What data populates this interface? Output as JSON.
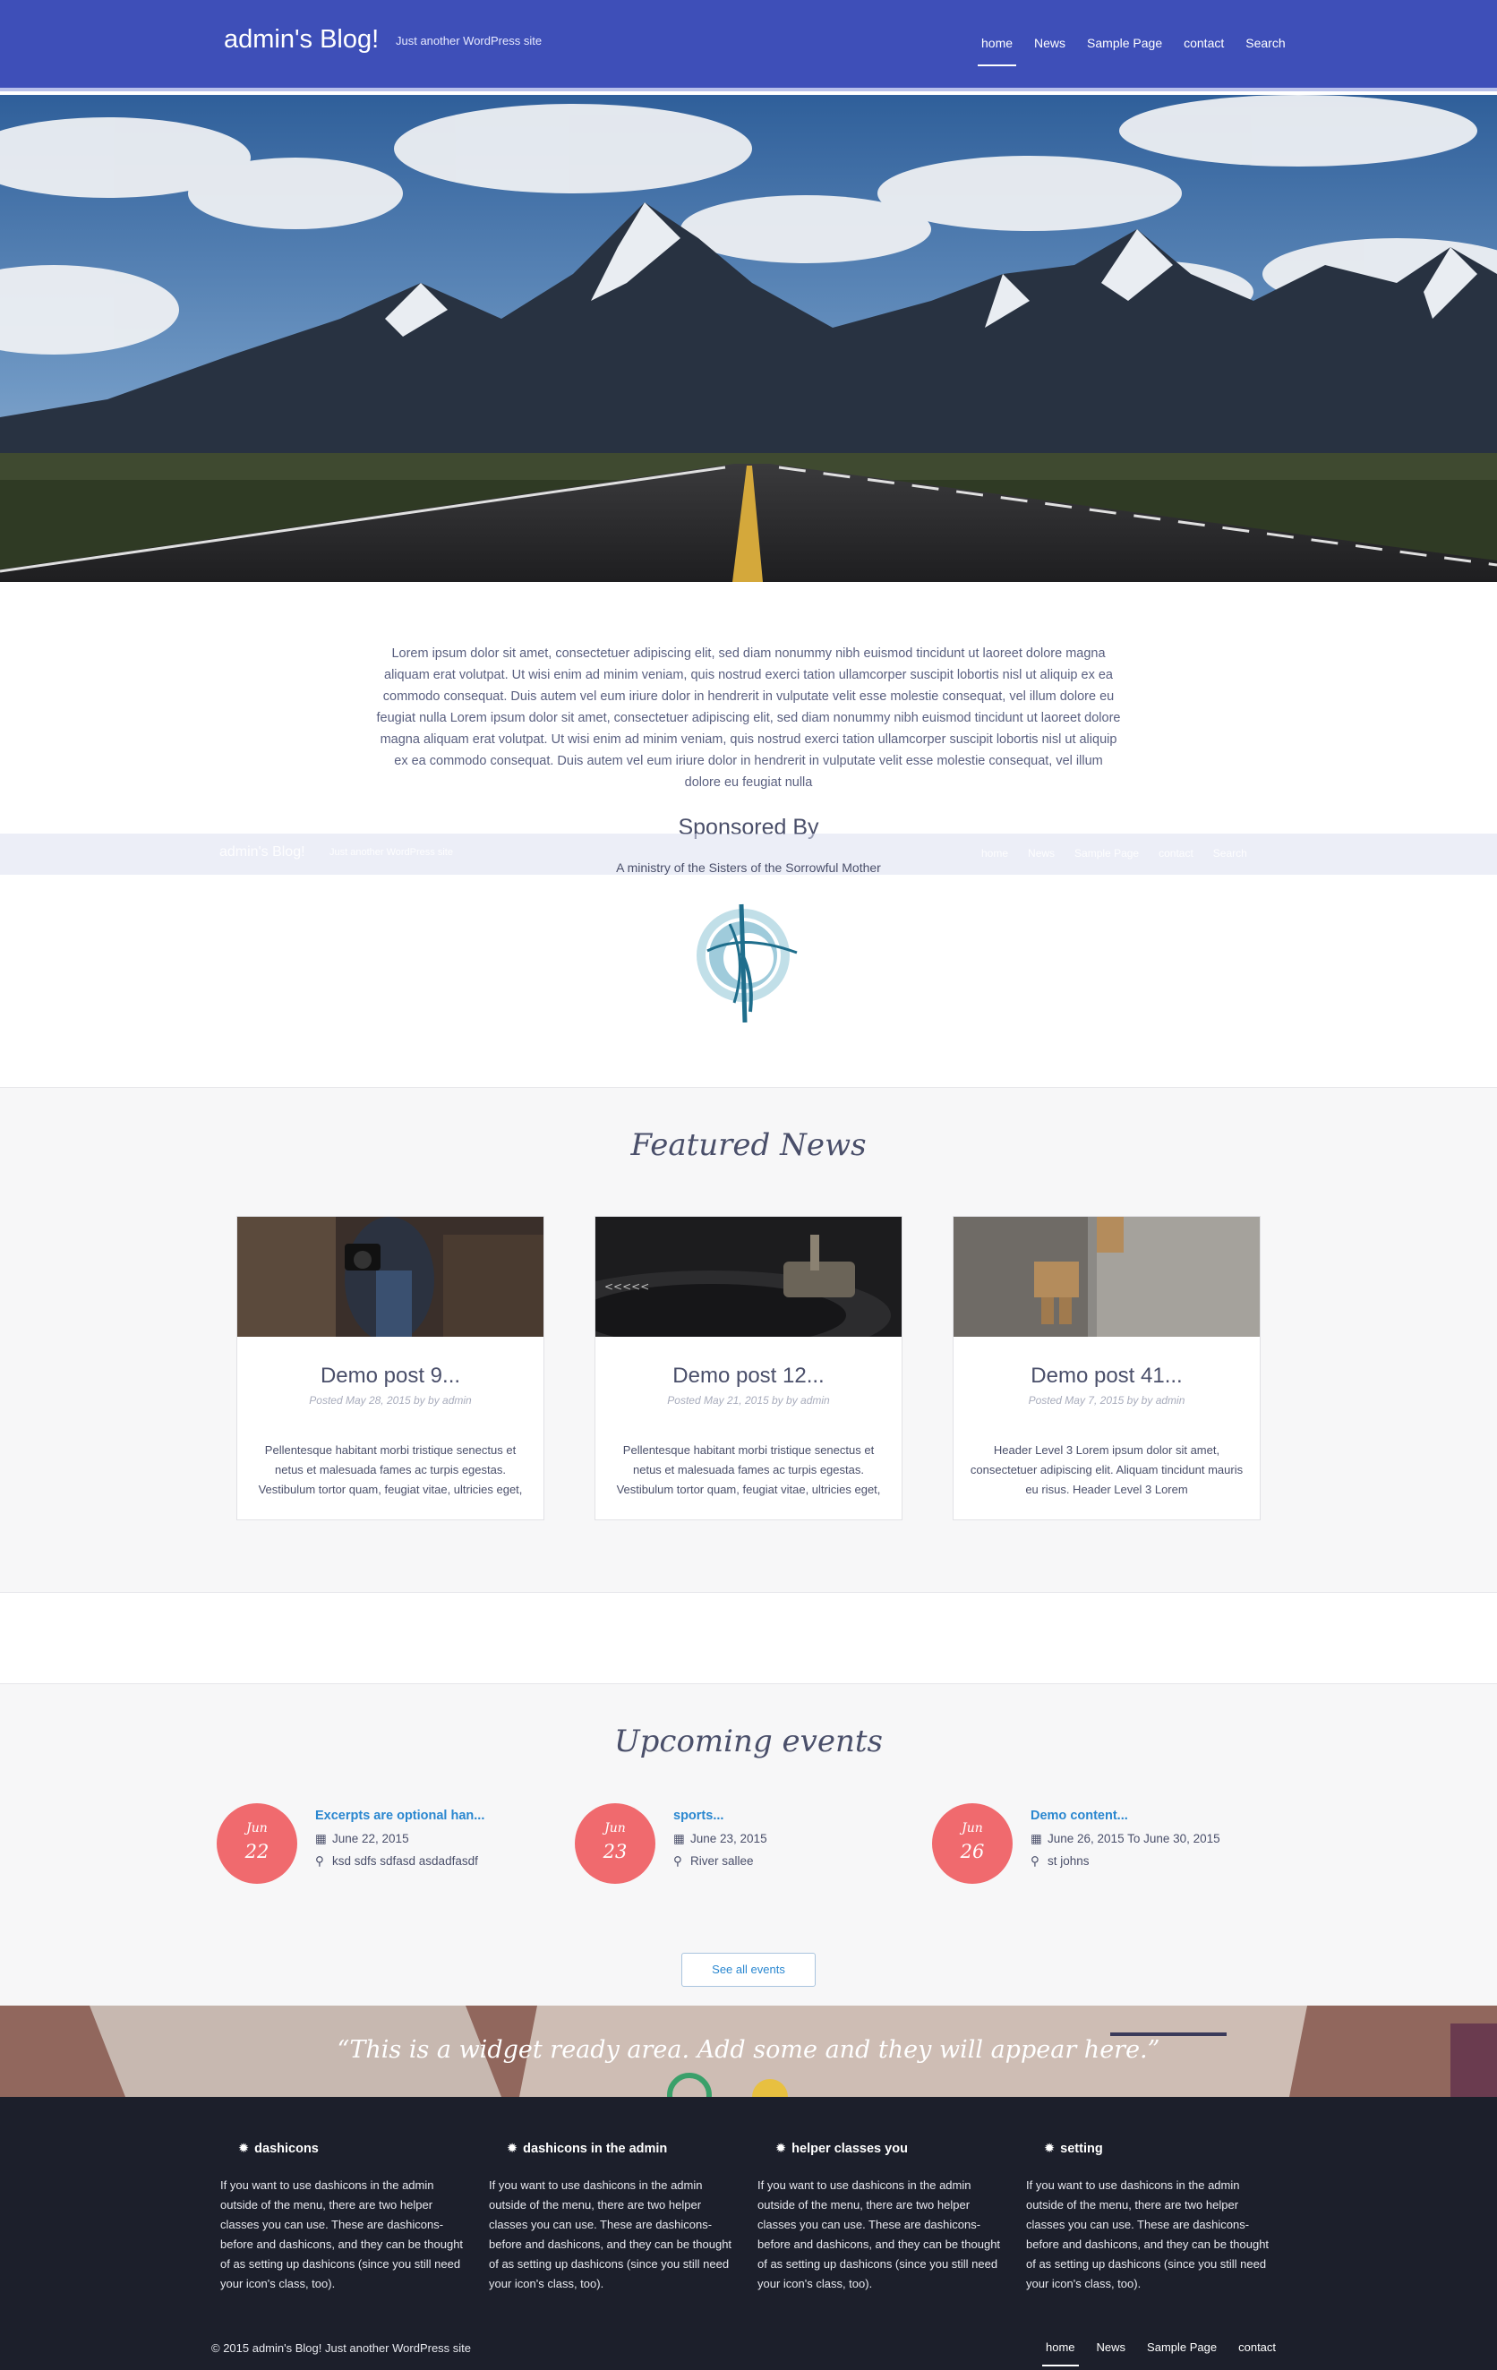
{
  "header": {
    "brand": "admin's Blog!",
    "tagline": "Just another WordPress site",
    "nav": [
      "home",
      "News",
      "Sample Page",
      "contact",
      "Search"
    ]
  },
  "intro": {
    "text": "Lorem ipsum dolor sit amet, consectetuer adipiscing elit, sed diam nonummy nibh euismod tincidunt ut laoreet dolore magna aliquam erat volutpat. Ut wisi enim ad minim veniam, quis nostrud exerci tation ullamcorper suscipit lobortis nisl ut aliquip ex ea commodo consequat. Duis autem vel eum iriure dolor in hendrerit in vulputate velit esse molestie consequat, vel illum dolore eu feugiat nulla Lorem ipsum dolor sit amet, consectetuer adipiscing elit, sed diam nonummy nibh euismod tincidunt ut laoreet dolore magna aliquam erat volutpat. Ut wisi enim ad minim veniam, quis nostrud exerci tation ullamcorper suscipit lobortis nisl ut aliquip ex ea commodo consequat. Duis autem vel eum iriure dolor in hendrerit in vulputate velit esse molestie consequat, vel illum dolore eu feugiat nulla"
  },
  "sponsor": {
    "title": "Sponsored By",
    "subtitle": "A ministry of the Sisters of the Sorrowful Mother"
  },
  "featured": {
    "title": "Featured News",
    "posts": [
      {
        "title": "Demo post 9...",
        "meta": "Posted May 28, 2015 by by admin",
        "excerpt": "Pellentesque habitant morbi tristique senectus et netus et malesuada fames ac turpis egestas. Vestibulum tortor quam, feugiat vitae, ultricies eget,"
      },
      {
        "title": "Demo post 12...",
        "meta": "Posted May 21, 2015 by by admin",
        "excerpt": "Pellentesque habitant morbi tristique senectus et netus et malesuada fames ac turpis egestas. Vestibulum tortor quam, feugiat vitae, ultricies eget,"
      },
      {
        "title": "Demo post 41...",
        "meta": "Posted May 7, 2015 by by admin",
        "excerpt": "Header Level 3 Lorem ipsum dolor sit amet, consectetuer adipiscing elit. Aliquam tincidunt mauris eu risus. Header Level 3 Lorem"
      }
    ]
  },
  "events": {
    "title": "Upcoming events",
    "items": [
      {
        "month": "Jun",
        "day": "22",
        "title": "Excerpts are optional han...",
        "date": "June 22, 2015",
        "location": "ksd sdfs sdfasd asdadfasdf"
      },
      {
        "month": "Jun",
        "day": "23",
        "title": "sports...",
        "date": "June 23, 2015",
        "location": "River sallee"
      },
      {
        "month": "Jun",
        "day": "26",
        "title": "Demo content...",
        "date": "June 26, 2015 To June 30, 2015",
        "location": "st johns"
      }
    ],
    "see_all": "See all events"
  },
  "widget": {
    "text": "“This is a widget ready area. Add some and they will appear here.”"
  },
  "footer": {
    "columns": [
      {
        "heading": "dashicons",
        "body": "If you want to use dashicons in the admin outside of the menu, there are two helper classes you can use. These are dashicons-before and dashicons, and they can be thought of as setting up dashicons (since you still need your icon's class, too)."
      },
      {
        "heading": "dashicons in the admin",
        "body": "If you want to use dashicons in the admin outside of the menu, there are two helper classes you can use. These are dashicons-before and dashicons, and they can be thought of as setting up dashicons (since you still need your icon's class, too)."
      },
      {
        "heading": "helper classes you",
        "body": "If you want to use dashicons in the admin outside of the menu, there are two helper classes you can use. These are dashicons-before and dashicons, and they can be thought of as setting up dashicons (since you still need your icon's class, too)."
      },
      {
        "heading": "setting",
        "body": "If you want to use dashicons in the admin outside of the menu, there are two helper classes you can use. These are dashicons-before and dashicons, and they can be thought of as setting up dashicons (since you still need your icon's class, too)."
      }
    ],
    "copyright": "© 2015 admin's Blog! Just another WordPress site",
    "nav": [
      "home",
      "News",
      "Sample Page",
      "contact"
    ]
  },
  "colors": {
    "header_bg": "#3e4fb8",
    "event_circle": "#f06a6e",
    "link_blue": "#2a87d0",
    "footer_bg": "#1c1f2b"
  }
}
